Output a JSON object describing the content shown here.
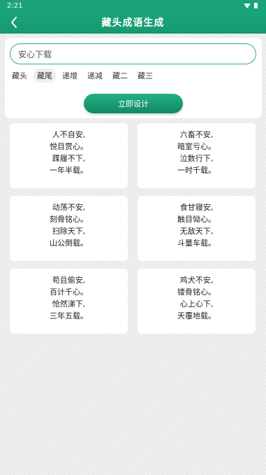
{
  "status": {
    "time": "2:21"
  },
  "header": {
    "title": "藏头成语生成"
  },
  "search": {
    "value": "安心下载"
  },
  "modes": [
    "藏头",
    "藏尾",
    "递增",
    "递减",
    "藏二",
    "藏三"
  ],
  "active_mode": "藏尾",
  "design_button": "立即设计",
  "results": [
    [
      "人不自安,",
      "悦目赏心。",
      "蹀履不下,",
      "一年半载。"
    ],
    [
      "六畜不安,",
      "暗室亏心。",
      "泣数行下,",
      "一时千载。"
    ],
    [
      "动荡不安,",
      "刻骨铭心。",
      "扫除天下,",
      "山公倒载。"
    ],
    [
      "食甘寝安,",
      "触目恸心。",
      "无敌天下,",
      "斗量车载。"
    ],
    [
      "苟且偷安,",
      "百计千心。",
      "怆然涕下,",
      "三年五载。"
    ],
    [
      "鸡犬不安,",
      "镂骨铭心。",
      "心上心下,",
      "天覆地载。"
    ]
  ]
}
